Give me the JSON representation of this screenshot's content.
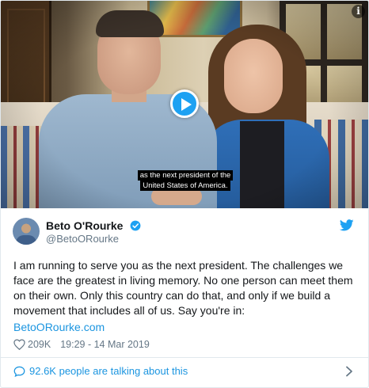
{
  "video": {
    "caption_line1": "as the next president of the",
    "caption_line2": "United States of America.",
    "info_label": "i"
  },
  "author": {
    "name": "Beto O'Rourke",
    "handle": "@BetoORourke"
  },
  "tweet": {
    "text": "I am running to serve you as the next president. The challenges we face are the greatest in living memory. No one person can meet them on their own. Only this country can do that, and only if we build a movement that includes all of us. Say you're in:",
    "link": "BetoORourke.com",
    "likes": "209K",
    "timestamp": "19:29 - 14 Mar 2019"
  },
  "footer": {
    "talking": "92.6K people are talking about this"
  },
  "colors": {
    "brand": "#1da1f2",
    "link": "#1b95e0",
    "muted": "#657786"
  },
  "icons": [
    "play-icon",
    "info-icon",
    "verified-icon",
    "twitter-bird-icon",
    "heart-icon",
    "reply-bubble-icon",
    "chevron-right-icon"
  ]
}
